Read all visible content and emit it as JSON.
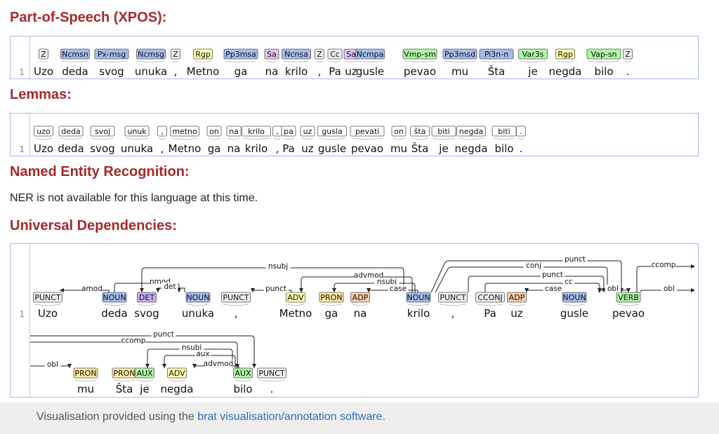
{
  "sections": {
    "xpos_title": "Part-of-Speech (XPOS):",
    "lemma_title": "Lemmas:",
    "ner_title": "Named Entity Recognition:",
    "ner_message": "NER is not available for this language at this time.",
    "ud_title": "Universal Dependencies:"
  },
  "line_number": "1",
  "xpos": {
    "tokens": [
      {
        "word": "Uzo",
        "tag": "Z",
        "color": "#eeeeee"
      },
      {
        "word": "deda",
        "tag": "Ncmsn",
        "color": "#a4bced"
      },
      {
        "word": "svog",
        "tag": "Px-msg",
        "color": "#a4bced"
      },
      {
        "word": "unuka",
        "tag": "Ncmsg",
        "color": "#a4bced"
      },
      {
        "word": ",",
        "tag": "Z",
        "color": "#eeeeee"
      },
      {
        "word": "Metno",
        "tag": "Rgp",
        "color": "#fffda8"
      },
      {
        "word": "ga",
        "tag": "Pp3msa",
        "color": "#a4bced"
      },
      {
        "word": "na",
        "tag": "Sa",
        "color": "#e3c4f0"
      },
      {
        "word": "krilo",
        "tag": "Ncnsa",
        "color": "#a4bced"
      },
      {
        "word": ",",
        "tag": "Z",
        "color": "#eeeeee"
      },
      {
        "word": "Pa",
        "tag": "Cc",
        "color": "#eeeeee"
      },
      {
        "word": "uz",
        "tag": "Sa",
        "color": "#e3c4f0"
      },
      {
        "word": "gusle",
        "tag": "Ncmpa",
        "color": "#a4bced"
      },
      {
        "word": "pevao",
        "tag": "Vmp-sm",
        "color": "#adf6a2"
      },
      {
        "word": "mu",
        "tag": "Pp3msd",
        "color": "#a4bced"
      },
      {
        "word": "Šta",
        "tag": "Pi3n-n",
        "color": "#a4bced"
      },
      {
        "word": "je",
        "tag": "Var3s",
        "color": "#adf6a2"
      },
      {
        "word": "negda",
        "tag": "Rgp",
        "color": "#fffda8"
      },
      {
        "word": "bilo",
        "tag": "Vap-sn",
        "color": "#adf6a2"
      },
      {
        "word": ".",
        "tag": "Z",
        "color": "#eeeeee"
      }
    ]
  },
  "lemmas": {
    "tokens": [
      {
        "word": "Uzo",
        "lemma": "uzo"
      },
      {
        "word": "deda",
        "lemma": "deda"
      },
      {
        "word": "svog",
        "lemma": "svoj"
      },
      {
        "word": "unuka",
        "lemma": "unuk"
      },
      {
        "word": ",",
        "lemma": ","
      },
      {
        "word": "Metno",
        "lemma": "metno"
      },
      {
        "word": "ga",
        "lemma": "on"
      },
      {
        "word": "na",
        "lemma": "na"
      },
      {
        "word": "krilo",
        "lemma": "krilo"
      },
      {
        "word": ",",
        "lemma": ","
      },
      {
        "word": "Pa",
        "lemma": "pa"
      },
      {
        "word": "uz",
        "lemma": "uz"
      },
      {
        "word": "gusle",
        "lemma": "gusla"
      },
      {
        "word": "pevao",
        "lemma": "pevati"
      },
      {
        "word": "mu",
        "lemma": "on"
      },
      {
        "word": "Šta",
        "lemma": "šta"
      },
      {
        "word": "je",
        "lemma": "biti"
      },
      {
        "word": "negda",
        "lemma": "negda"
      },
      {
        "word": "bilo",
        "lemma": "biti"
      },
      {
        "word": ".",
        "lemma": "."
      }
    ]
  },
  "ud": {
    "colors": {
      "PUNCT": "#eeeeee",
      "NOUN": "#a4bced",
      "DET": "#ccadf6",
      "ADV": "#fffda8",
      "PRON": "#ffe8a0",
      "ADP": "#ffccaa",
      "CCONJ": "#eeeeee",
      "VERB": "#adf6a2",
      "AUX": "#adf6a2"
    },
    "row1": [
      {
        "word": "Uzo",
        "upos": "PUNCT"
      },
      {
        "word": "deda",
        "upos": "NOUN"
      },
      {
        "word": "svog",
        "upos": "DET"
      },
      {
        "word": "unuka",
        "upos": "NOUN"
      },
      {
        "word": ",",
        "upos": "PUNCT"
      },
      {
        "word": "Metno",
        "upos": "ADV"
      },
      {
        "word": "ga",
        "upos": "PRON"
      },
      {
        "word": "na",
        "upos": "ADP"
      },
      {
        "word": "krilo",
        "upos": "NOUN"
      },
      {
        "word": ",",
        "upos": "PUNCT"
      },
      {
        "word": "Pa",
        "upos": "CCONJ"
      },
      {
        "word": "uz",
        "upos": "ADP"
      },
      {
        "word": "gusle",
        "upos": "NOUN"
      },
      {
        "word": "pevao",
        "upos": "VERB"
      }
    ],
    "row2": [
      {
        "word": "mu",
        "upos": "PRON"
      },
      {
        "word": "Šta",
        "upos": "PRON"
      },
      {
        "word": "je",
        "upos": "AUX"
      },
      {
        "word": "negda",
        "upos": "ADV"
      },
      {
        "word": "bilo",
        "upos": "AUX"
      },
      {
        "word": ".",
        "upos": "PUNCT"
      }
    ],
    "arcs": [
      "amod",
      "nmod",
      "det",
      "nsubj",
      "punct",
      "advmod",
      "nsubj",
      "case",
      "punct",
      "conj",
      "punct",
      "cc",
      "case",
      "obl",
      "ccomp",
      "obl",
      "punct",
      "ccomp",
      "nsubj",
      "aux",
      "advmod",
      "obl"
    ]
  },
  "footer": {
    "prefix": "Visualisation provided using the ",
    "link": "brat visualisation/annotation software",
    "suffix": "."
  }
}
